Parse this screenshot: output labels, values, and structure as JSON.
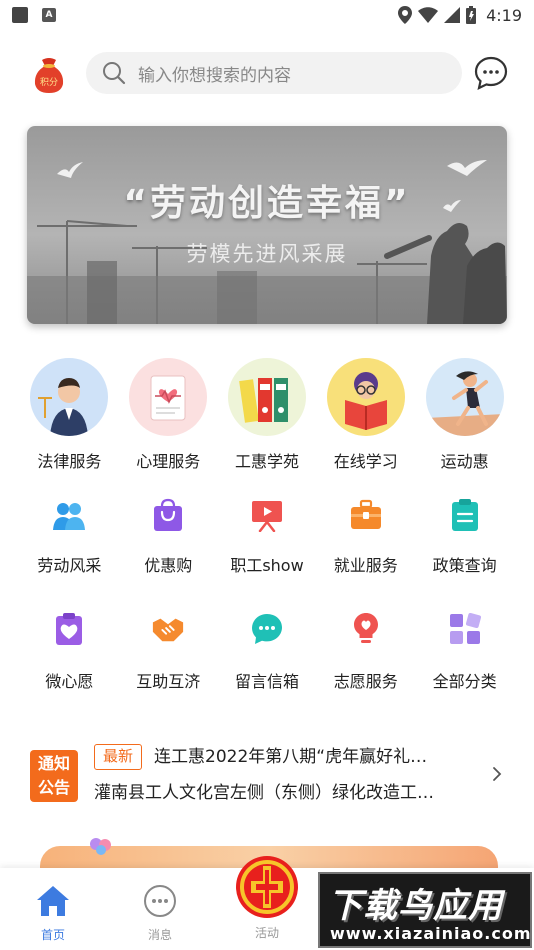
{
  "status_bar": {
    "time": "4:19"
  },
  "header": {
    "points_label": "积分",
    "search_placeholder": "输入你想搜索的内容"
  },
  "banner": {
    "title": "“劳动创造幸福”",
    "subtitle": "劳模先进风采展"
  },
  "services_row1": [
    {
      "label": "法律服务",
      "icon": "lawyer-icon"
    },
    {
      "label": "心理服务",
      "icon": "heart-report-icon"
    },
    {
      "label": "工惠学苑",
      "icon": "binders-icon"
    },
    {
      "label": "在线学习",
      "icon": "reader-icon"
    },
    {
      "label": "运动惠",
      "icon": "runner-icon"
    }
  ],
  "services_row2": [
    {
      "label": "劳动风采",
      "icon": "people-icon",
      "color": "#2f9be8"
    },
    {
      "label": "优惠购",
      "icon": "shopping-bag-icon",
      "color": "#8e58e6"
    },
    {
      "label": "职工show",
      "icon": "presentation-icon",
      "color": "#ef5350"
    },
    {
      "label": "就业服务",
      "icon": "briefcase-icon",
      "color": "#f5892b"
    },
    {
      "label": "政策查询",
      "icon": "clipboard-icon",
      "color": "#1fc0b6"
    }
  ],
  "services_row3": [
    {
      "label": "微心愿",
      "icon": "heart-clipboard-icon",
      "color": "#9b5de5"
    },
    {
      "label": "互助互济",
      "icon": "handshake-icon",
      "color": "#f58a2e"
    },
    {
      "label": "留言信箱",
      "icon": "chat-bubble-icon",
      "color": "#1fc0b6"
    },
    {
      "label": "志愿服务",
      "icon": "lightbulb-icon",
      "color": "#ef5350"
    },
    {
      "label": "全部分类",
      "icon": "categories-icon",
      "color": "#9b79e8"
    }
  ],
  "notice": {
    "badge_line1": "通知",
    "badge_line2": "公告",
    "tag": "最新",
    "line1": "连工惠2022年第八期“虎年赢好礼…",
    "line2": "灌南县工人文化宫左侧（东侧）绿化改造工…"
  },
  "tab_bar": {
    "home": "首页",
    "messages": "消息",
    "activities": "活动"
  },
  "watermark": {
    "big": "下载鸟应用",
    "small": "www.xiazainiao.com"
  },
  "colors": {
    "accent_blue": "#3d7be0",
    "notice_orange": "#f36b1c"
  }
}
